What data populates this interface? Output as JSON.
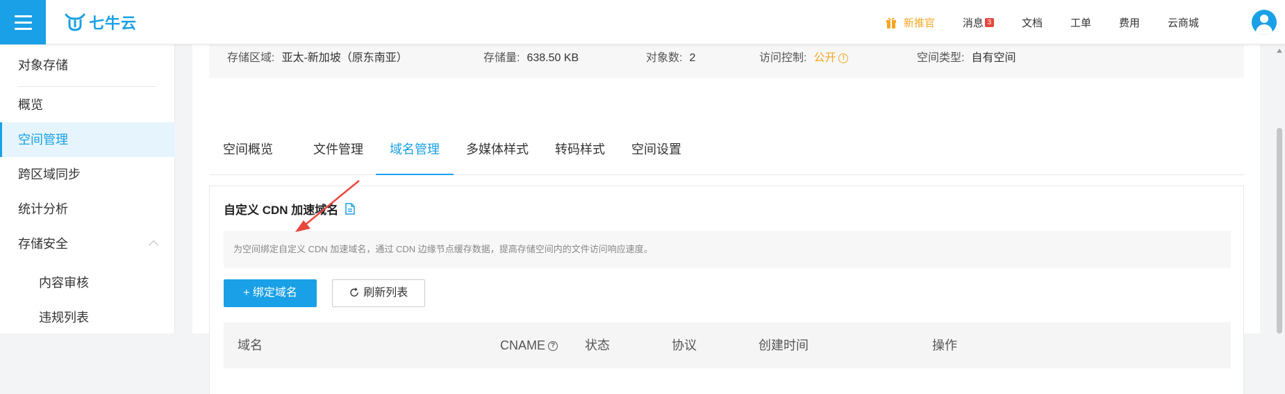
{
  "header": {
    "logo_text": "七牛云",
    "nav": [
      {
        "label": "新推官",
        "highlight": true
      },
      {
        "label": "消息",
        "badge": "3"
      },
      {
        "label": "文档"
      },
      {
        "label": "工单"
      },
      {
        "label": "费用"
      },
      {
        "label": "云商城"
      }
    ]
  },
  "sidebar": {
    "items": [
      {
        "label": "对象存储"
      },
      {
        "label": "概览"
      },
      {
        "label": "空间管理"
      },
      {
        "label": "跨区域同步"
      },
      {
        "label": "统计分析"
      },
      {
        "label": "存储安全"
      },
      {
        "label": "内容审核"
      },
      {
        "label": "违规列表"
      }
    ]
  },
  "info_bar": {
    "region_label": "存储区域:",
    "region_value": "亚太-新加坡（原东南亚）",
    "storage_label": "存储量:",
    "storage_value": "638.50 KB",
    "objects_label": "对象数:",
    "objects_value": "2",
    "access_label": "访问控制:",
    "access_value": "公开",
    "type_label": "空间类型:",
    "type_value": "自有空间"
  },
  "tabs": [
    {
      "label": "空间概览"
    },
    {
      "label": "文件管理"
    },
    {
      "label": "域名管理"
    },
    {
      "label": "多媒体样式"
    },
    {
      "label": "转码样式"
    },
    {
      "label": "空间设置"
    }
  ],
  "panel": {
    "title": "自定义 CDN 加速域名",
    "tip": "为空间绑定自定义 CDN 加速域名，通过 CDN 边缘节点缓存数据，提高存储空间内的文件访问响应速度。",
    "bind_button": "+ 绑定域名",
    "refresh_button": "刷新列表",
    "columns": [
      "域名",
      "CNAME",
      "状态",
      "协议",
      "创建时间",
      "操作"
    ]
  },
  "colors": {
    "accent": "#1aa0e6",
    "highlight": "#f5a623",
    "annotation": "#e8473e"
  }
}
